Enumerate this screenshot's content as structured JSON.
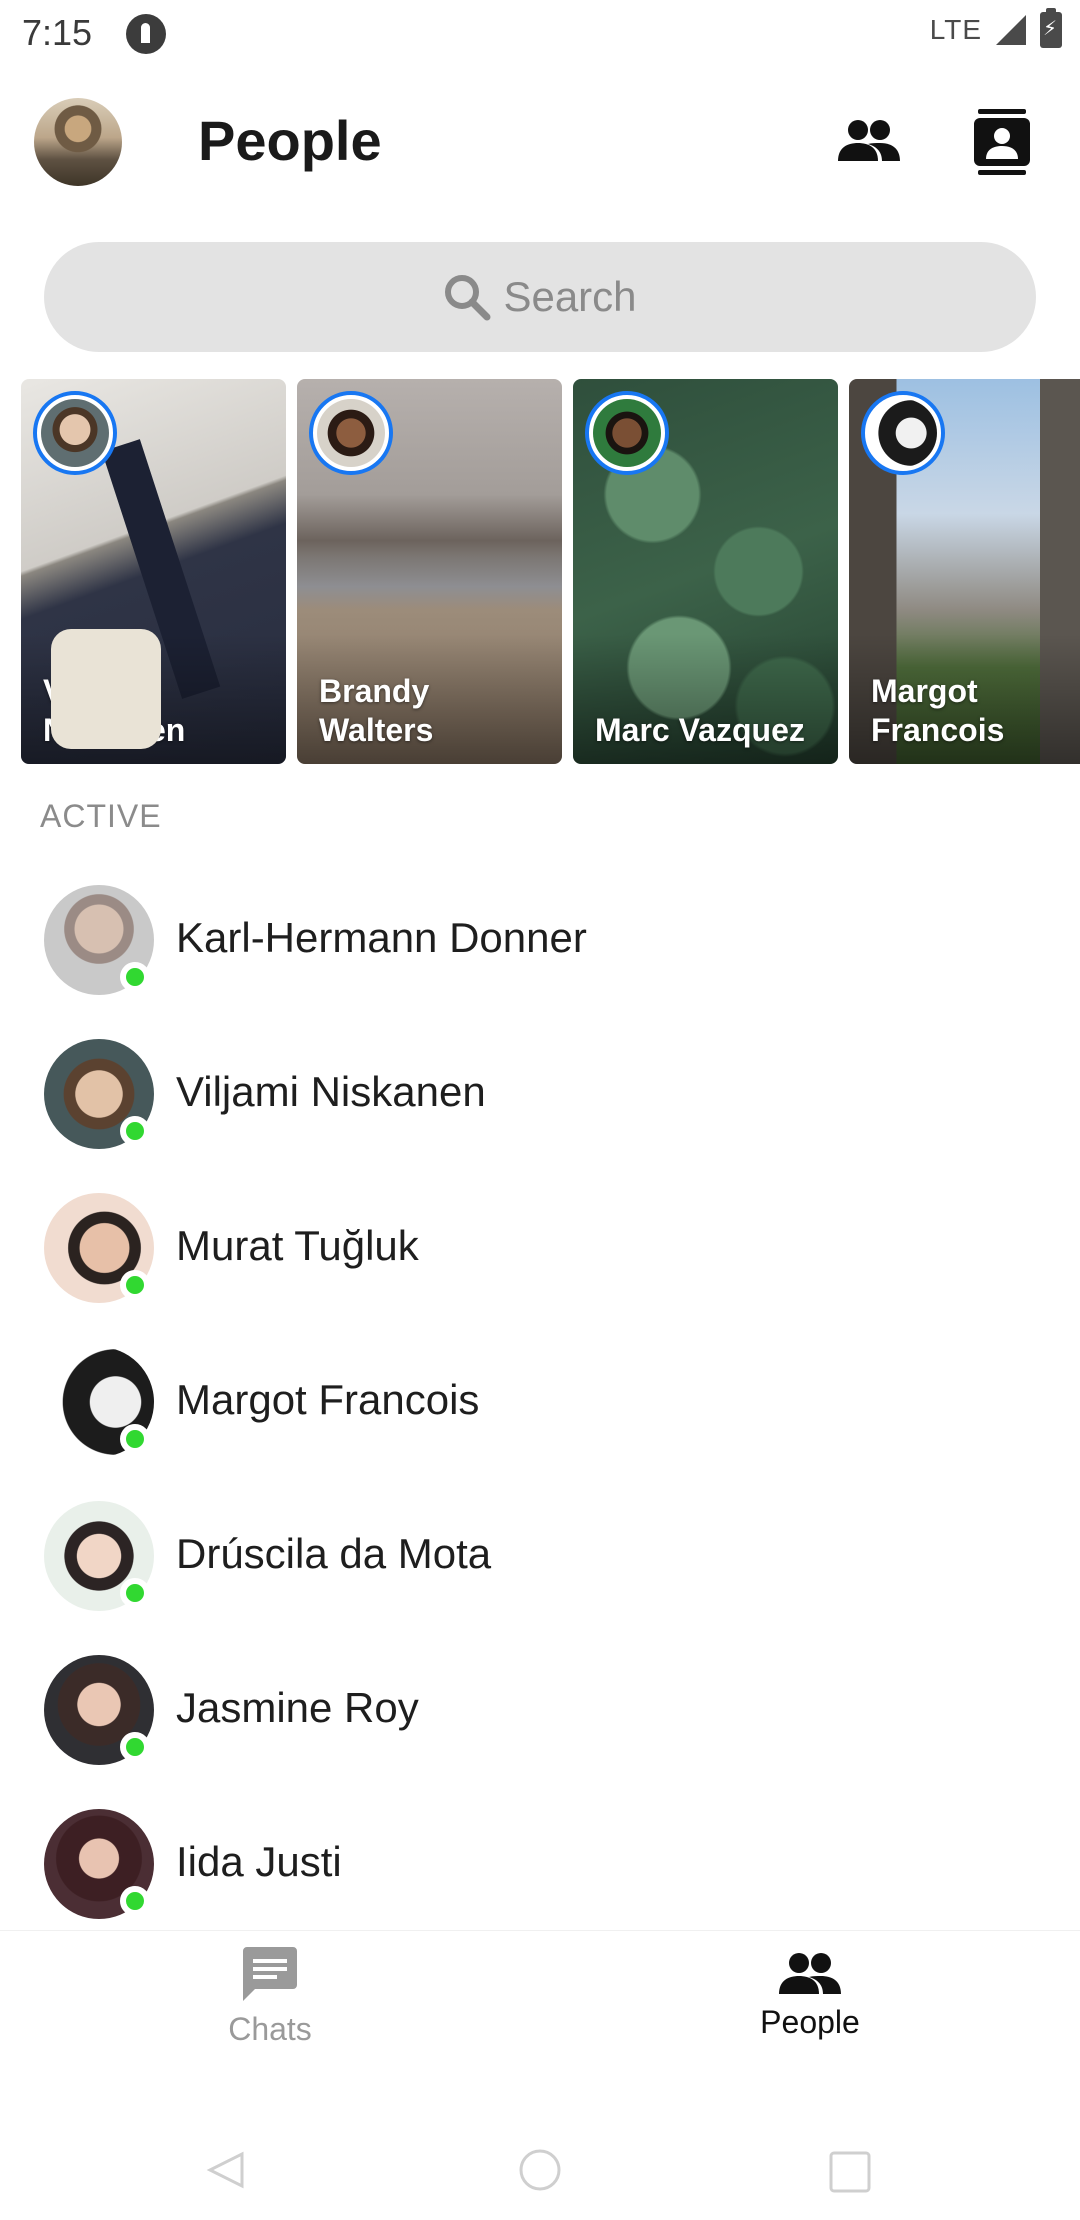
{
  "status_bar": {
    "time": "7:15",
    "network": "LTE",
    "app_icon": "app-notification-icon",
    "signal_icon": "signal-icon",
    "battery_icon": "battery-charging-icon"
  },
  "header": {
    "title": "People",
    "profile_icon": "profile-avatar",
    "actions": [
      {
        "icon": "people-icon"
      },
      {
        "icon": "contacts-book-icon"
      }
    ]
  },
  "search": {
    "placeholder": "Search",
    "icon": "search-icon"
  },
  "stories": [
    {
      "name": "Viljami Niskanen"
    },
    {
      "name": "Brandy Walters"
    },
    {
      "name": "Marc Vazquez"
    },
    {
      "name": "Margot Francois"
    }
  ],
  "active": {
    "label": "ACTIVE",
    "contacts": [
      {
        "name": "Karl-Hermann Donner",
        "online": true
      },
      {
        "name": "Viljami Niskanen",
        "online": true
      },
      {
        "name": "Murat Tuğluk",
        "online": true
      },
      {
        "name": "Margot Francois",
        "online": true
      },
      {
        "name": "Drúscila da Mota",
        "online": true
      },
      {
        "name": "Jasmine Roy",
        "online": true
      },
      {
        "name": "Iida Justi",
        "online": true
      }
    ]
  },
  "bottom_nav": {
    "items": [
      {
        "label": "Chats",
        "icon": "chat-bubble-icon",
        "selected": false
      },
      {
        "label": "People",
        "icon": "people-icon",
        "selected": true
      }
    ]
  },
  "colors": {
    "story_ring": "#1877f2",
    "online_dot": "#31d831",
    "search_bg": "#e3e3e3",
    "inactive_nav": "#9a9a9a"
  }
}
